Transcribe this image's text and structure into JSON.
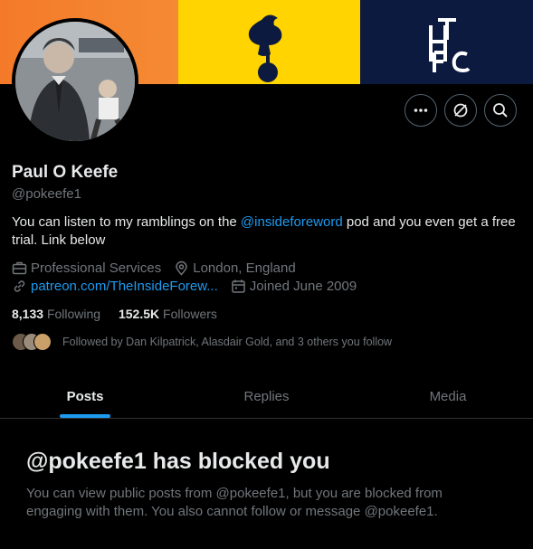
{
  "profile": {
    "name": "Paul O Keefe",
    "handle": "@pokeefe1",
    "bio_before": "You can listen to my ramblings on the ",
    "bio_mention": "@insideforeword",
    "bio_after": " pod and you even get a free trial. Link below",
    "category": "Professional Services",
    "location": "London, England",
    "website": "patreon.com/TheInsideForew...",
    "joined": "Joined June 2009"
  },
  "stats": {
    "following_count": "8,133",
    "following_label": "Following",
    "followers_count": "152.5K",
    "followers_label": "Followers"
  },
  "followed_by": "Followed by Dan Kilpatrick, Alasdair Gold, and 3 others you follow",
  "tabs": [
    {
      "label": "Posts"
    },
    {
      "label": "Replies"
    },
    {
      "label": "Media"
    }
  ],
  "blocked": {
    "title": "@pokeefe1 has blocked you",
    "message": "You can view public posts from @pokeefe1, but you are blocked from engaging with them. You also cannot follow or message @pokeefe1."
  },
  "icons": {
    "more": "more-horizontal-icon",
    "unblock": "block-icon",
    "search": "search-icon",
    "category": "briefcase-icon",
    "location": "location-pin-icon",
    "link": "link-icon",
    "calendar": "calendar-icon"
  },
  "colors": {
    "accent": "#1d9bf0",
    "secondary_text": "#71767b",
    "banner_orange": "#f47a2a",
    "banner_yellow": "#ffd400",
    "banner_navy": "#0d1a3f"
  }
}
